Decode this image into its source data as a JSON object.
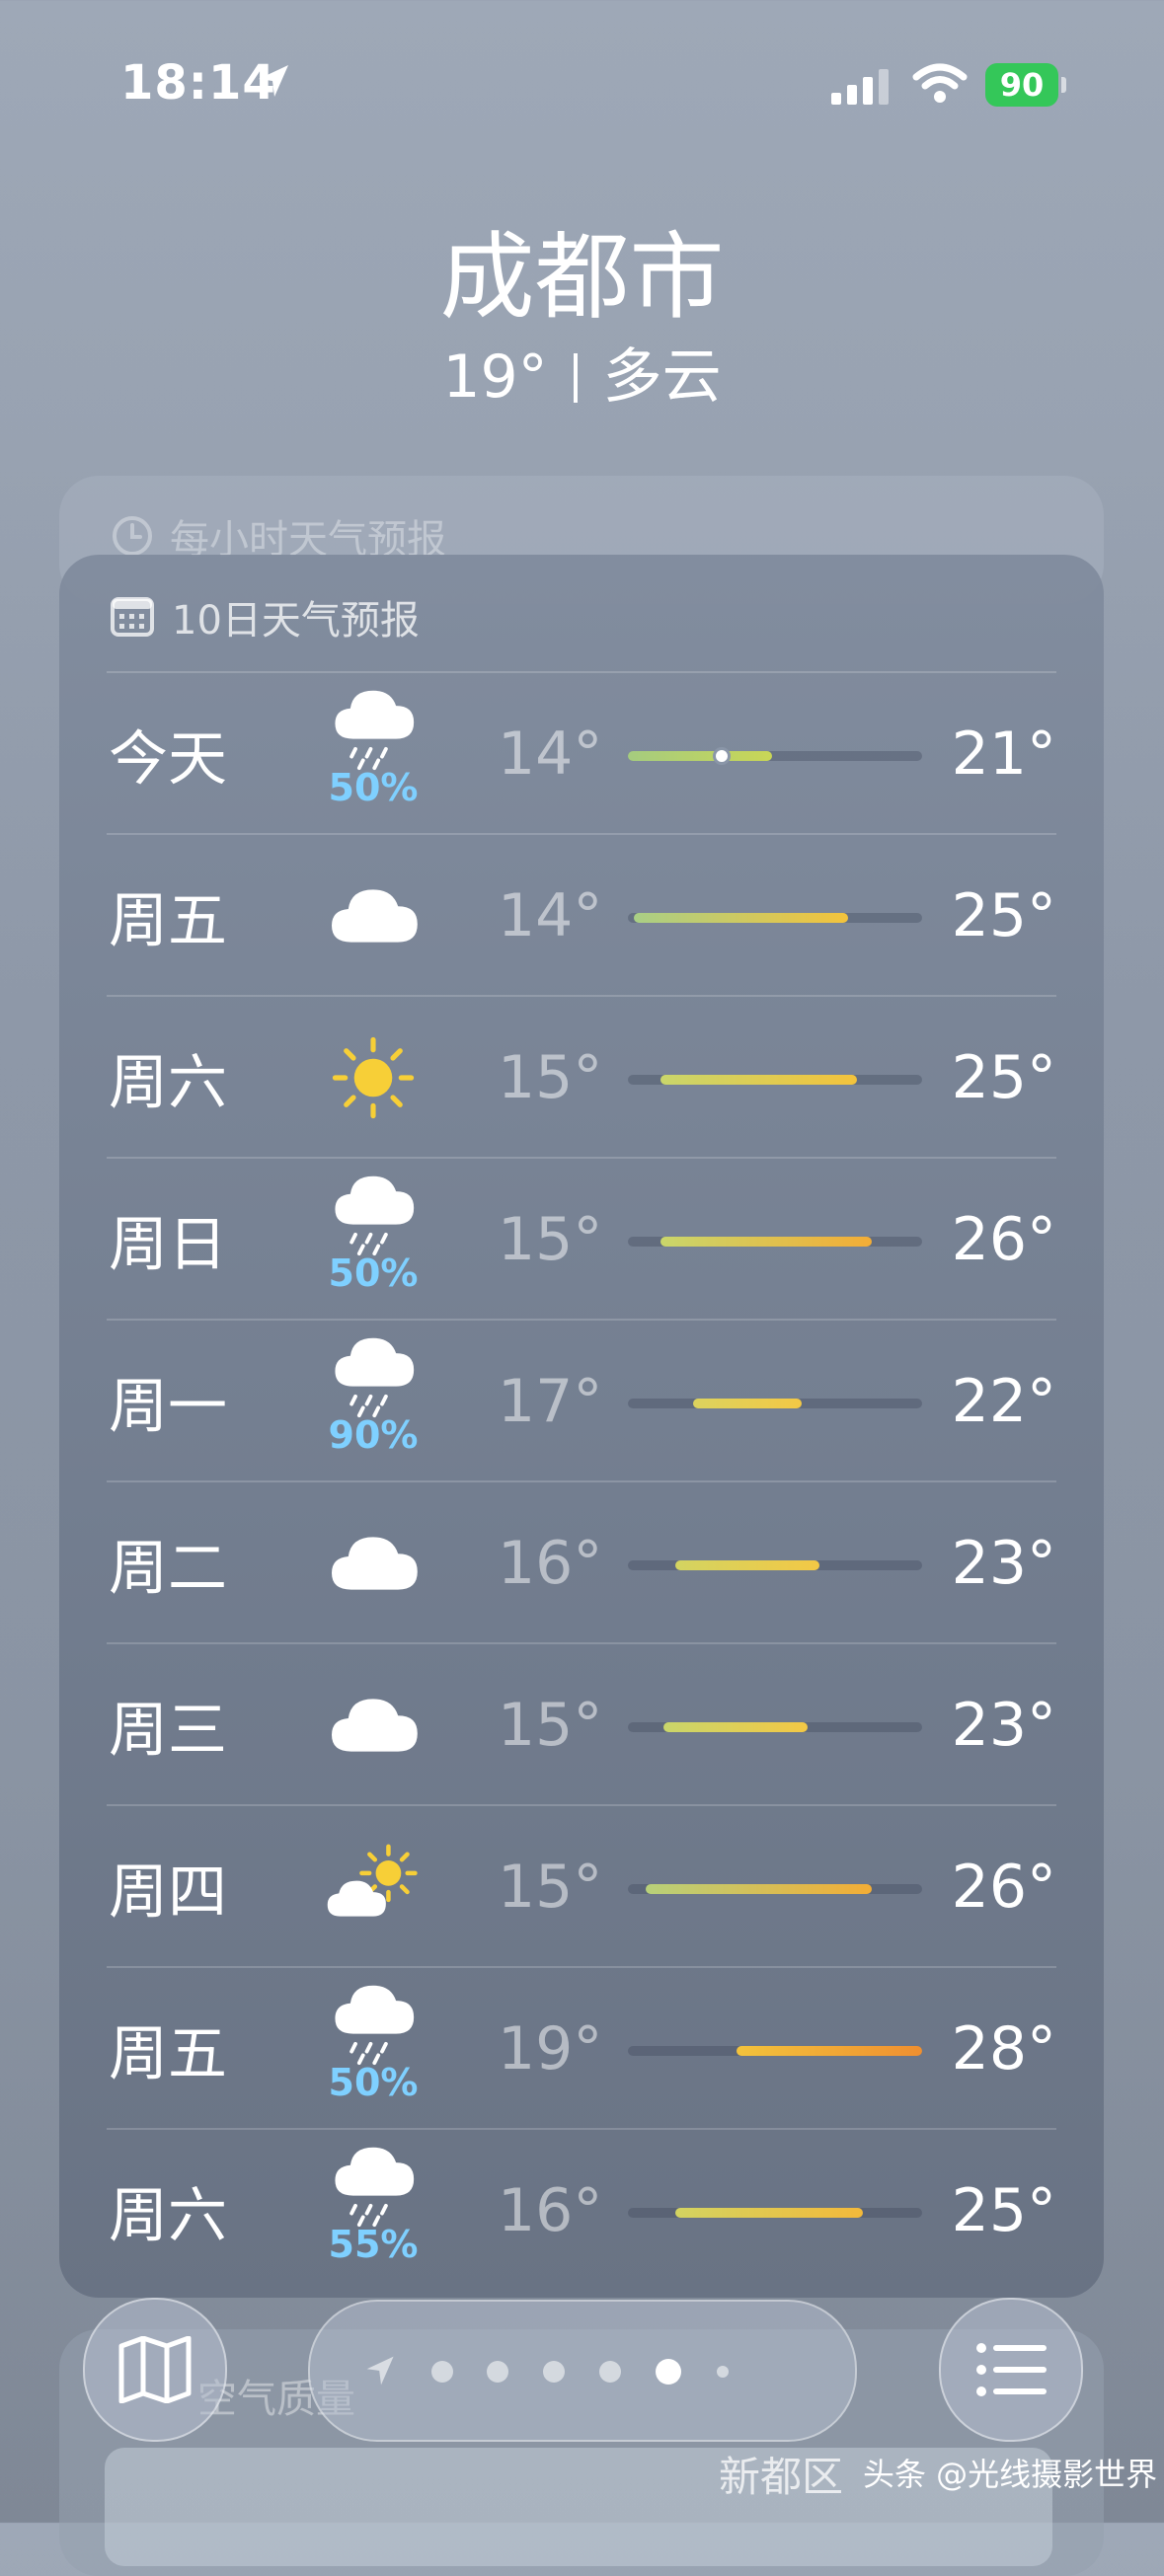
{
  "status_bar": {
    "time": "18:14",
    "battery": "90",
    "icons": [
      "location-arrow-icon",
      "signal-icon",
      "wifi-icon",
      "battery-icon"
    ]
  },
  "header": {
    "city": "成都市",
    "temperature": "19°",
    "condition": "多云"
  },
  "hourly_forecast": {
    "title": "每小时天气预报",
    "icon": "clock-icon"
  },
  "daily_forecast": {
    "title": "10日天气预报",
    "icon": "calendar-icon",
    "days": [
      {
        "day": "今天",
        "icon": "cloud-rain-icon",
        "pop": "50%",
        "low": "14°",
        "high": "21°",
        "range": [
          0.0,
          0.49
        ],
        "current": 0.32,
        "colors": [
          "#a5cc7f",
          "#c9d656"
        ]
      },
      {
        "day": "周五",
        "icon": "cloud-icon",
        "pop": "",
        "low": "14°",
        "high": "25°",
        "range": [
          0.02,
          0.75
        ],
        "current": null,
        "colors": [
          "#a9cf86",
          "#f3c33c"
        ]
      },
      {
        "day": "周六",
        "icon": "sun-icon",
        "pop": "",
        "low": "15°",
        "high": "25°",
        "range": [
          0.11,
          0.78
        ],
        "current": null,
        "colors": [
          "#c9d66b",
          "#f3c33c"
        ]
      },
      {
        "day": "周日",
        "icon": "cloud-rain-icon",
        "pop": "50%",
        "low": "15°",
        "high": "26°",
        "range": [
          0.11,
          0.83
        ],
        "current": null,
        "colors": [
          "#c9d66b",
          "#f3ad36"
        ]
      },
      {
        "day": "周一",
        "icon": "cloud-rain-icon",
        "pop": "90%",
        "low": "17°",
        "high": "22°",
        "range": [
          0.22,
          0.59
        ],
        "current": null,
        "colors": [
          "#dcd35e",
          "#f3c845"
        ]
      },
      {
        "day": "周二",
        "icon": "cloud-icon",
        "pop": "",
        "low": "16°",
        "high": "23°",
        "range": [
          0.16,
          0.65
        ],
        "current": null,
        "colors": [
          "#d3d461",
          "#f3c845"
        ]
      },
      {
        "day": "周三",
        "icon": "cloud-icon",
        "pop": "",
        "low": "15°",
        "high": "23°",
        "range": [
          0.12,
          0.61
        ],
        "current": null,
        "colors": [
          "#c9d66b",
          "#f3c845"
        ]
      },
      {
        "day": "周四",
        "icon": "partly-cloudy-icon",
        "pop": "",
        "low": "15°",
        "high": "26°",
        "range": [
          0.06,
          0.83
        ],
        "current": null,
        "colors": [
          "#b8d17a",
          "#f3ad36"
        ]
      },
      {
        "day": "周五",
        "icon": "cloud-rain-icon",
        "pop": "50%",
        "low": "19°",
        "high": "28°",
        "range": [
          0.37,
          1.0
        ],
        "current": null,
        "colors": [
          "#f3c33c",
          "#ef8f30"
        ]
      },
      {
        "day": "周六",
        "icon": "cloud-rain-icon",
        "pop": "55%",
        "low": "16°",
        "high": "25°",
        "range": [
          0.16,
          0.8
        ],
        "current": null,
        "colors": [
          "#d3d461",
          "#f3b93a"
        ]
      }
    ]
  },
  "air_quality": {
    "label": "空气质量"
  },
  "bottom_bar": {
    "district": "新都区",
    "watermark": "头条 @光线摄影世界",
    "page_count": 7,
    "active_page": 5
  }
}
